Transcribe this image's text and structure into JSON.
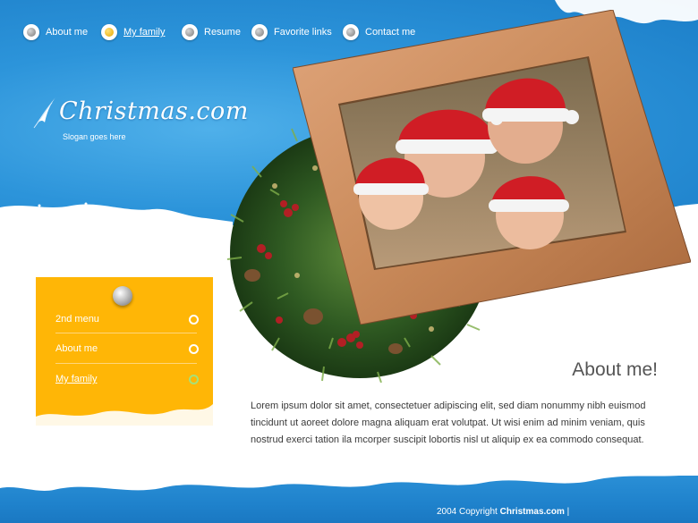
{
  "nav": {
    "items": [
      {
        "label": "About me",
        "active": false
      },
      {
        "label": "My family",
        "active": true
      },
      {
        "label": "Resume",
        "active": false
      },
      {
        "label": "Favorite links",
        "active": false
      },
      {
        "label": "Contact me",
        "active": false
      }
    ]
  },
  "logo": {
    "title": "Christmas.com",
    "slogan": "Slogan goes here"
  },
  "side_menu": {
    "items": [
      {
        "label": "2nd menu",
        "active": false
      },
      {
        "label": "About me",
        "active": false
      },
      {
        "label": "My family",
        "active": true
      }
    ]
  },
  "content": {
    "title": "About me!",
    "body": "Lorem ipsum dolor sit amet, consectetuer adipiscing elit, sed diam nonummy nibh euismod tincidunt ut aoreet dolore magna aliquam erat volutpat. Ut wisi enim ad minim veniam, quis nostrud exerci tation ila mcorper suscipit lobortis nisl ut aliquip ex ea commodo consequat."
  },
  "footer": {
    "copyright_prefix": "2004 Copyright",
    "copyright_site": "Christmas.com",
    "separator": "|"
  },
  "colors": {
    "sky_blue": "#2c94da",
    "panel_orange": "#ffb606",
    "frame_wood": "#c98a5a",
    "text_gray": "#3a3a3a"
  }
}
